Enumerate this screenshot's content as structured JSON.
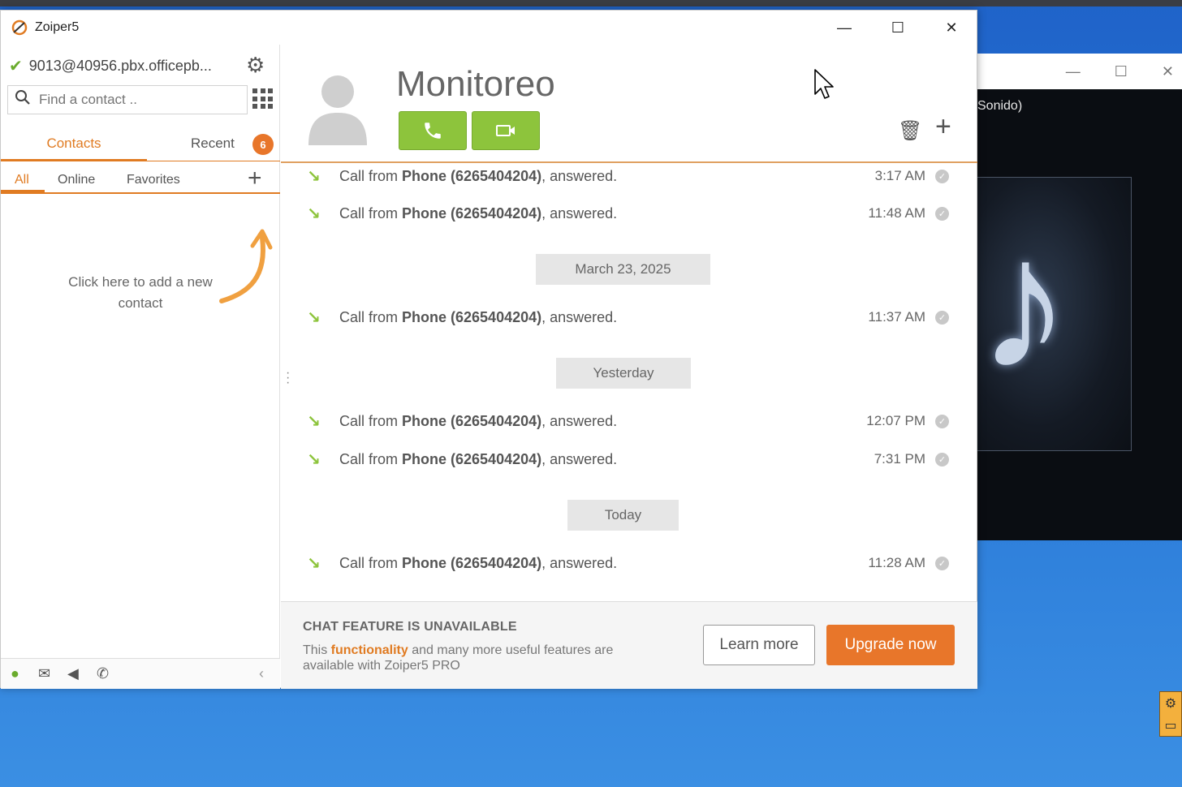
{
  "app": {
    "title": "Zoiper5",
    "window_controls": {
      "minimize": "—",
      "maximize": "☐",
      "close": "✕"
    }
  },
  "account": {
    "name": "9013@40956.pbx.officepb...",
    "status": "registered"
  },
  "search": {
    "placeholder": "Find a contact .."
  },
  "tabs": {
    "contacts": "Contacts",
    "recent": "Recent",
    "recent_badge": "6"
  },
  "subtabs": {
    "all": "All",
    "online": "Online",
    "favorites": "Favorites"
  },
  "hint": {
    "text": "Click here to add a new contact"
  },
  "contact": {
    "name": "Monitoreo"
  },
  "history": [
    {
      "direction": "incoming",
      "prefix": "Call from ",
      "caller": "Phone (6265404204)",
      "suffix": ", answered.",
      "time": "3:17 AM"
    },
    {
      "direction": "incoming",
      "prefix": "Call from ",
      "caller": "Phone (6265404204)",
      "suffix": ", answered.",
      "time": "11:48 AM"
    },
    {
      "separator": "March 23, 2025"
    },
    {
      "direction": "incoming",
      "prefix": "Call from ",
      "caller": "Phone (6265404204)",
      "suffix": ", answered.",
      "time": "11:37 AM"
    },
    {
      "separator": "Yesterday"
    },
    {
      "direction": "incoming",
      "prefix": "Call from ",
      "caller": "Phone (6265404204)",
      "suffix": ", answered.",
      "time": "12:07 PM"
    },
    {
      "direction": "incoming",
      "prefix": "Call from ",
      "caller": "Phone (6265404204)",
      "suffix": ", answered.",
      "time": "7:31 PM"
    },
    {
      "separator": "Today"
    },
    {
      "direction": "incoming",
      "prefix": "Call from ",
      "caller": "Phone (6265404204)",
      "suffix": ", answered.",
      "time": "11:28 AM"
    }
  ],
  "banner": {
    "title": "CHAT FEATURE IS UNAVAILABLE",
    "text_before": "This ",
    "text_highlight": "functionality",
    "text_after": " and many more useful features are available with Zoiper5 PRO",
    "learn_more": "Learn more",
    "upgrade": "Upgrade now"
  },
  "background_window": {
    "title": "Sonido)",
    "controls": {
      "minimize": "—",
      "maximize": "☐",
      "close": "✕"
    }
  },
  "colors": {
    "accent": "#e07b22",
    "call_green": "#8dc43c",
    "badge": "#e8762a"
  }
}
